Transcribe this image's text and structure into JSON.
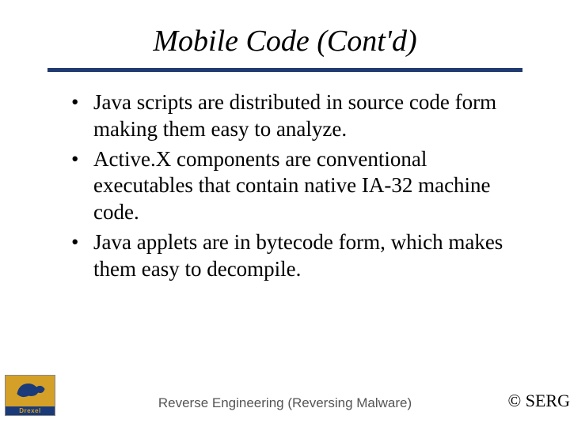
{
  "slide": {
    "title": "Mobile Code (Cont'd)",
    "bullets": [
      "Java scripts are distributed in source code form making them easy to analyze.",
      "Active.X components are conventional executables that contain native IA-32 machine code.",
      "Java applets are in bytecode form, which makes them easy to decompile."
    ],
    "footer_center": "Reverse Engineering (Reversing Malware)",
    "footer_right": "© SERG",
    "logo": {
      "name": "Drexel"
    }
  }
}
